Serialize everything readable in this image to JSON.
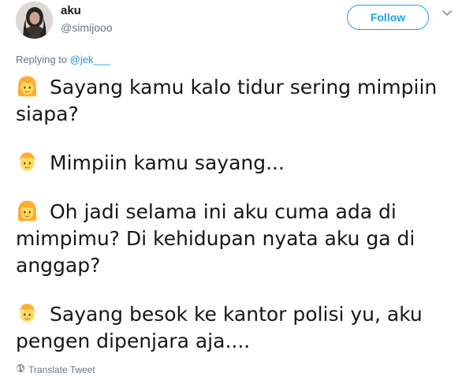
{
  "tweet": {
    "author": {
      "display_name": "aku",
      "handle": "@simijooo"
    },
    "follow_label": "Follow",
    "reply_prefix": "Replying to ",
    "reply_mention": "@jek___",
    "paragraphs": [
      {
        "emoji": "girl-emoji",
        "text": "Sayang kamu kalo tidur sering mimpiin siapa?"
      },
      {
        "emoji": "boy-emoji",
        "text": "Mimpiin kamu sayang..."
      },
      {
        "emoji": "girl-emoji",
        "text": "Oh jadi selama ini aku cuma ada di mimpimu? Di kehidupan nyata aku ga di anggap?"
      },
      {
        "emoji": "boy-emoji",
        "text": "Sayang besok ke kantor polisi yu, aku pengen dipenjara aja...."
      }
    ],
    "translate_label": "Translate Tweet"
  },
  "colors": {
    "accent": "#1da1f2",
    "mention": "#1b95e0",
    "secondary_text": "#657786",
    "primary_text": "#14171a"
  }
}
